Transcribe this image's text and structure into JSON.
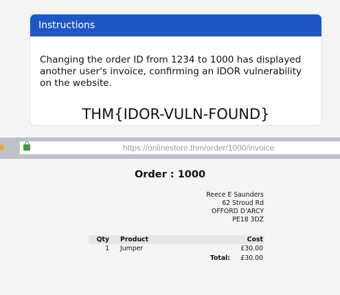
{
  "instructions": {
    "title": "Instructions",
    "message": "Changing the order ID from 1234 to 1000 has displayed another user's invoice, confirming an IDOR vulnerability on the website.",
    "flag": "THM{IDOR-VULN-FOUND}"
  },
  "browser": {
    "url": "https://onlinestore.thm/order/1000/invoice",
    "lock_icon": "lock-icon",
    "lock_color": "#3f9a3a"
  },
  "invoice": {
    "title": "Order : 1000",
    "address": [
      "Reece E Saunders",
      "62 Stroud Rd",
      "OFFORD D'ARCY",
      "PE18 3DZ"
    ],
    "table": {
      "headers": {
        "qty": "Qty",
        "product": "Product",
        "cost": "Cost"
      },
      "rows": [
        {
          "qty": "1",
          "product": "Jumper",
          "cost": "£30.00"
        }
      ],
      "total_label": "Total:",
      "total_value": "£30.00"
    }
  },
  "colors": {
    "header_blue": "#1f56c6",
    "browser_bar": "#bcc2c8"
  }
}
